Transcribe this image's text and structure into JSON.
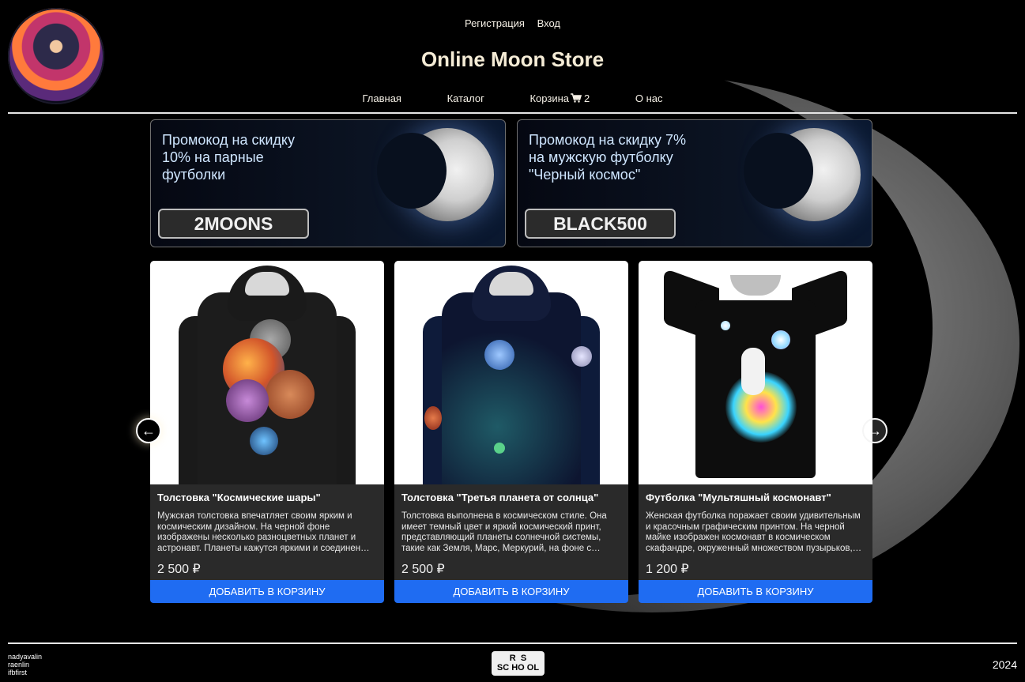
{
  "header": {
    "auth": {
      "register": "Регистрация",
      "login": "Вход"
    },
    "title": "Online Moon Store",
    "nav": {
      "home": "Главная",
      "catalog": "Каталог",
      "cart": "Корзина",
      "cart_count": "2",
      "about": "О нас"
    }
  },
  "promos": [
    {
      "text": "Промокод на скидку 10% на парные футболки",
      "code": "2MOONS"
    },
    {
      "text": "Промокод на скидку 7% на мужскую футболку \"Черный космос\"",
      "code": "BLACK500"
    }
  ],
  "products": [
    {
      "title": "Толстовка \"Космические шары\"",
      "description": "Мужская толстовка впечатляет своим ярким и космическим дизайном. На черной фоне изображены несколько разноцветных планет и астронавт. Планеты кажутся яркими и соединен…",
      "price": "2 500 ₽",
      "button": "ДОБАВИТЬ В КОРЗИНУ"
    },
    {
      "title": "Толстовка \"Третья планета от солнца\"",
      "description": "Толстовка выполнена в космическом стиле. Она имеет темный цвет и яркий космический принт, представляющий планеты солнечной системы, такие как Земля, Марс, Меркурий, на фоне с…",
      "price": "2 500 ₽",
      "button": "ДОБАВИТЬ В КОРЗИНУ"
    },
    {
      "title": "Футболка \"Мультяшный космонавт\"",
      "description": "Женская футболка поражает своим удивительным и красочным графическим принтом. На черной майке изображен космонавт в космическом скафандре, окруженный множеством пузырьков,…",
      "price": "1 200 ₽",
      "button": "ДОБАВИТЬ В КОРЗИНУ"
    }
  ],
  "footer": {
    "authors": [
      "nadyavalin",
      "raenlin",
      "ifbfirst"
    ],
    "school_logo": "RS SCHOOL",
    "year": "2024"
  },
  "colors": {
    "accent_button": "#1f6cf2",
    "card_body": "#2a2a2a",
    "promo_text": "#cfe6ff"
  },
  "icons": [
    "cart-icon",
    "arrow-left-icon",
    "arrow-right-icon"
  ]
}
